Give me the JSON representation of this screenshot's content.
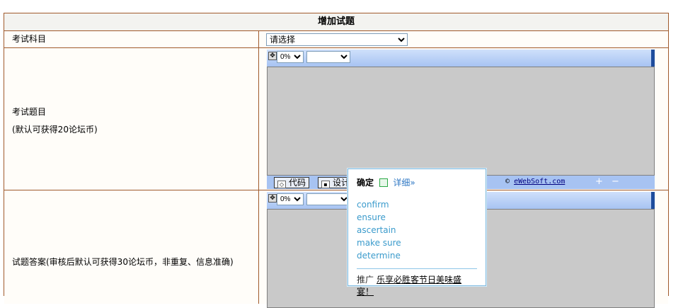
{
  "header": {
    "title": "增加试题"
  },
  "subject": {
    "label": "考试科目",
    "select_value": "请选择"
  },
  "question": {
    "label_line1": "考试题目",
    "label_line2": "(默认可获得20论坛币)"
  },
  "answer": {
    "label": "试题答案(审核后默认可获得30论坛币，非重复、信息准确)"
  },
  "editor": {
    "zoom_value": "0%",
    "code_label": "代码",
    "design_label": "设计",
    "copyright_symbol": "©",
    "copyright_link": "eWebSoft.com",
    "plus_icon": "+",
    "minus_icon": "−"
  },
  "dict_popup": {
    "confirm_label": "确定",
    "detail_label": "详细»",
    "words": [
      "confirm",
      "ensure",
      "ascertain",
      "make sure",
      "determine"
    ],
    "promo_prefix": "推广",
    "promo_link": "乐享必胜客节日美味盛宴！"
  },
  "colors": {
    "border": "#a05a2c",
    "editor_bar": "#a7c3f2",
    "popup_accent": "#3b9bcc"
  }
}
